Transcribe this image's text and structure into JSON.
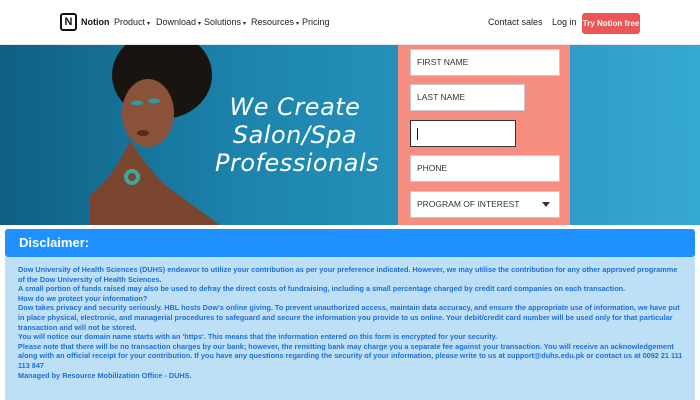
{
  "nav": {
    "brand": "Notion",
    "logo_letter": "N",
    "links": [
      {
        "label": "Product",
        "chevron": true
      },
      {
        "label": "Download",
        "chevron": true
      },
      {
        "label": "Solutions",
        "chevron": true
      },
      {
        "label": "Resources",
        "chevron": true
      },
      {
        "label": "Pricing",
        "chevron": false
      }
    ],
    "contact": "Contact sales",
    "login": "Log in",
    "cta": "Try Notion free"
  },
  "hero": {
    "headline_lines": [
      "We Create",
      "Salon/Spa",
      "Professionals"
    ]
  },
  "form": {
    "first_name": "FIRST NAME",
    "last_name": "LAST NAME",
    "email_value": "",
    "phone": "PHONE",
    "program": "PROGRAM OF INTEREST"
  },
  "disclaimer": {
    "title": "Disclaimer:",
    "paragraphs": [
      "Dow University of Health Sciences (DUHS) endeavor to utilize your contribution as per your preference indicated. However, we may utilise the contribution for any other approved programme of the Dow University of Health Sciences.",
      "A small portion of funds raised may also be used to defray the direct costs of fundraising, including a small percentage charged by credit card companies on each transaction.",
      "How do we protect your information?",
      "Dow takes privacy and security seriously. HBL hosts Dow's online giving. To prevent unauthorized access, maintain data accuracy, and ensure the appropriate use of information, we have put in place physical, electronic, and managerial procedures to safeguard and secure the information you provide to us online. Your debit/credit card number will be used only for that particular transaction and will not be stored.",
      "You will notice our domain name starts with an 'https'. This means that the information entered on this form is encrypted for your security.",
      "Please note that there will be no transaction charges by our bank; however, the remitting bank may charge you a separate fee against your transaction. You will receive an acknowledgement along with an official receipt for your contribution. If you have any questions regarding the security of your information, please write to us at support@duhs.edu.pk or contact us at 0092 21 111 113 847",
      "Managed by Resource Mobilization Office - DUHS."
    ]
  },
  "colors": {
    "cta": "#eb5757",
    "form_panel": "#f58d80",
    "disclaimer_header": "#1e90ff",
    "disclaimer_body_bg": "#bde0f7",
    "disclaimer_text": "#1e6fd9"
  }
}
